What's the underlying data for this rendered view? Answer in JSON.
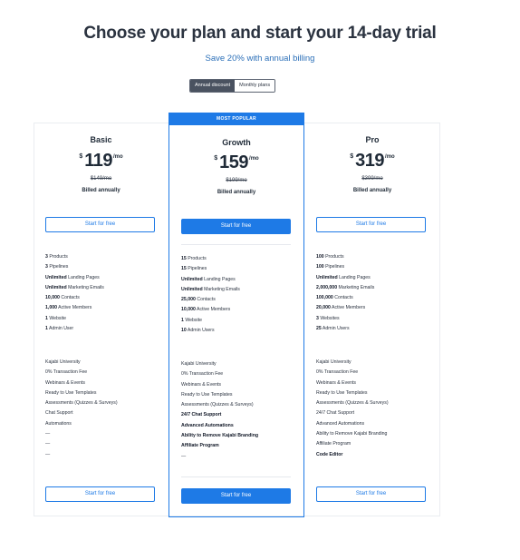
{
  "header": {
    "title": "Choose your plan and start your 14-day trial",
    "subtitle": "Save 20% with annual billing"
  },
  "billing_toggle": {
    "annual_label": "Annual discount",
    "monthly_label": "Monthly plans",
    "selected": "Annual discount"
  },
  "colors": {
    "accent": "#1e7ae6",
    "subtitle": "#2b6fb8",
    "toggle_active": "#4a5260"
  },
  "plans": {
    "basic": {
      "name": "Basic",
      "currency": "$",
      "price": "119",
      "period": "/mo",
      "old_price": "$149/mo",
      "billed": "Billed annually",
      "cta_top": "Start for free",
      "cta_bottom": "Start for free",
      "limits": [
        {
          "value": "3",
          "label": " Products"
        },
        {
          "value": "3",
          "label": " Pipelines"
        },
        {
          "value": "Unlimited",
          "label": " Landing Pages"
        },
        {
          "value": "Unlimited",
          "label": " Marketing Emails"
        },
        {
          "value": "10,000",
          "label": " Contacts"
        },
        {
          "value": "1,000",
          "label": " Active Members"
        },
        {
          "value": "1",
          "label": " Website"
        },
        {
          "value": "1",
          "label": " Admin User"
        }
      ],
      "features": [
        "Kajabi University",
        "0% Transaction Fee",
        "Webinars & Events",
        "Ready to Use Templates",
        "Assessments (Quizzes & Surveys)",
        "Chat Support",
        "Automations",
        "—",
        "—",
        "—"
      ]
    },
    "growth": {
      "badge": "MOST POPULAR",
      "name": "Growth",
      "currency": "$",
      "price": "159",
      "period": "/mo",
      "old_price": "$199/mo",
      "billed": "Billed annually",
      "cta_top": "Start for free",
      "cta_bottom": "Start for free",
      "limits": [
        {
          "value": "15",
          "label": " Products"
        },
        {
          "value": "15",
          "label": " Pipelines"
        },
        {
          "value": "Unlimited",
          "label": " Landing Pages"
        },
        {
          "value": "Unlimited",
          "label": " Marketing Emails"
        },
        {
          "value": "25,000",
          "label": " Contacts"
        },
        {
          "value": "10,000",
          "label": " Active Members"
        },
        {
          "value": "1",
          "label": " Website"
        },
        {
          "value": "10",
          "label": " Admin Users"
        }
      ],
      "features": [
        "Kajabi University",
        "0% Transaction Fee",
        "Webinars & Events",
        "Ready to Use Templates",
        "Assessments (Quizzes & Surveys)",
        "24/7 Chat Support",
        "Advanced Automations",
        "Ability to Remove Kajabi Branding",
        "Affiliate Program",
        "—"
      ]
    },
    "pro": {
      "name": "Pro",
      "currency": "$",
      "price": "319",
      "period": "/mo",
      "old_price": "$399/mo",
      "billed": "Billed annually",
      "cta_top": "Start for free",
      "cta_bottom": "Start for free",
      "limits": [
        {
          "value": "100",
          "label": " Products"
        },
        {
          "value": "100",
          "label": " Pipelines"
        },
        {
          "value": "Unlimited",
          "label": " Landing Pages"
        },
        {
          "value": "2,000,000",
          "label": " Marketing Emails"
        },
        {
          "value": "100,000",
          "label": " Contacts"
        },
        {
          "value": "20,000",
          "label": " Active Members"
        },
        {
          "value": "3",
          "label": " Websites"
        },
        {
          "value": "25",
          "label": " Admin Users"
        }
      ],
      "features": [
        "Kajabi University",
        "0% Transaction Fee",
        "Webinars & Events",
        "Ready to Use Templates",
        "Assessments (Quizzes & Surveys)",
        "24/7 Chat Support",
        "Advanced Automations",
        "Ability to Remove Kajabi Branding",
        "Affiliate Program",
        "Code Editor"
      ]
    }
  }
}
